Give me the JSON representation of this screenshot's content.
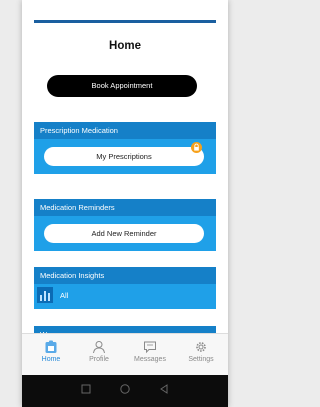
{
  "header": {
    "title": "Home"
  },
  "book_button": {
    "label": "Book Appointment"
  },
  "sections": [
    {
      "title": "Prescription Medication",
      "action": "My Prescriptions",
      "badge": "lock-icon"
    },
    {
      "title": "Medication Reminders",
      "action": "Add New Reminder"
    },
    {
      "title": "Medication Insights",
      "item_label": "All",
      "item_icon": "bar-chart-icon"
    }
  ],
  "peek_section": {
    "title": "W"
  },
  "tabs": [
    {
      "label": "Home",
      "icon": "home-icon",
      "active": true
    },
    {
      "label": "Profile",
      "icon": "profile-icon",
      "active": false
    },
    {
      "label": "Messages",
      "icon": "messages-icon",
      "active": false
    },
    {
      "label": "Settings",
      "icon": "settings-icon",
      "active": false
    }
  ],
  "colors": {
    "accent": "#1fa0e8",
    "section_header": "#1580c8",
    "badge": "#f7a11a",
    "active_tab": "#2589d9"
  }
}
